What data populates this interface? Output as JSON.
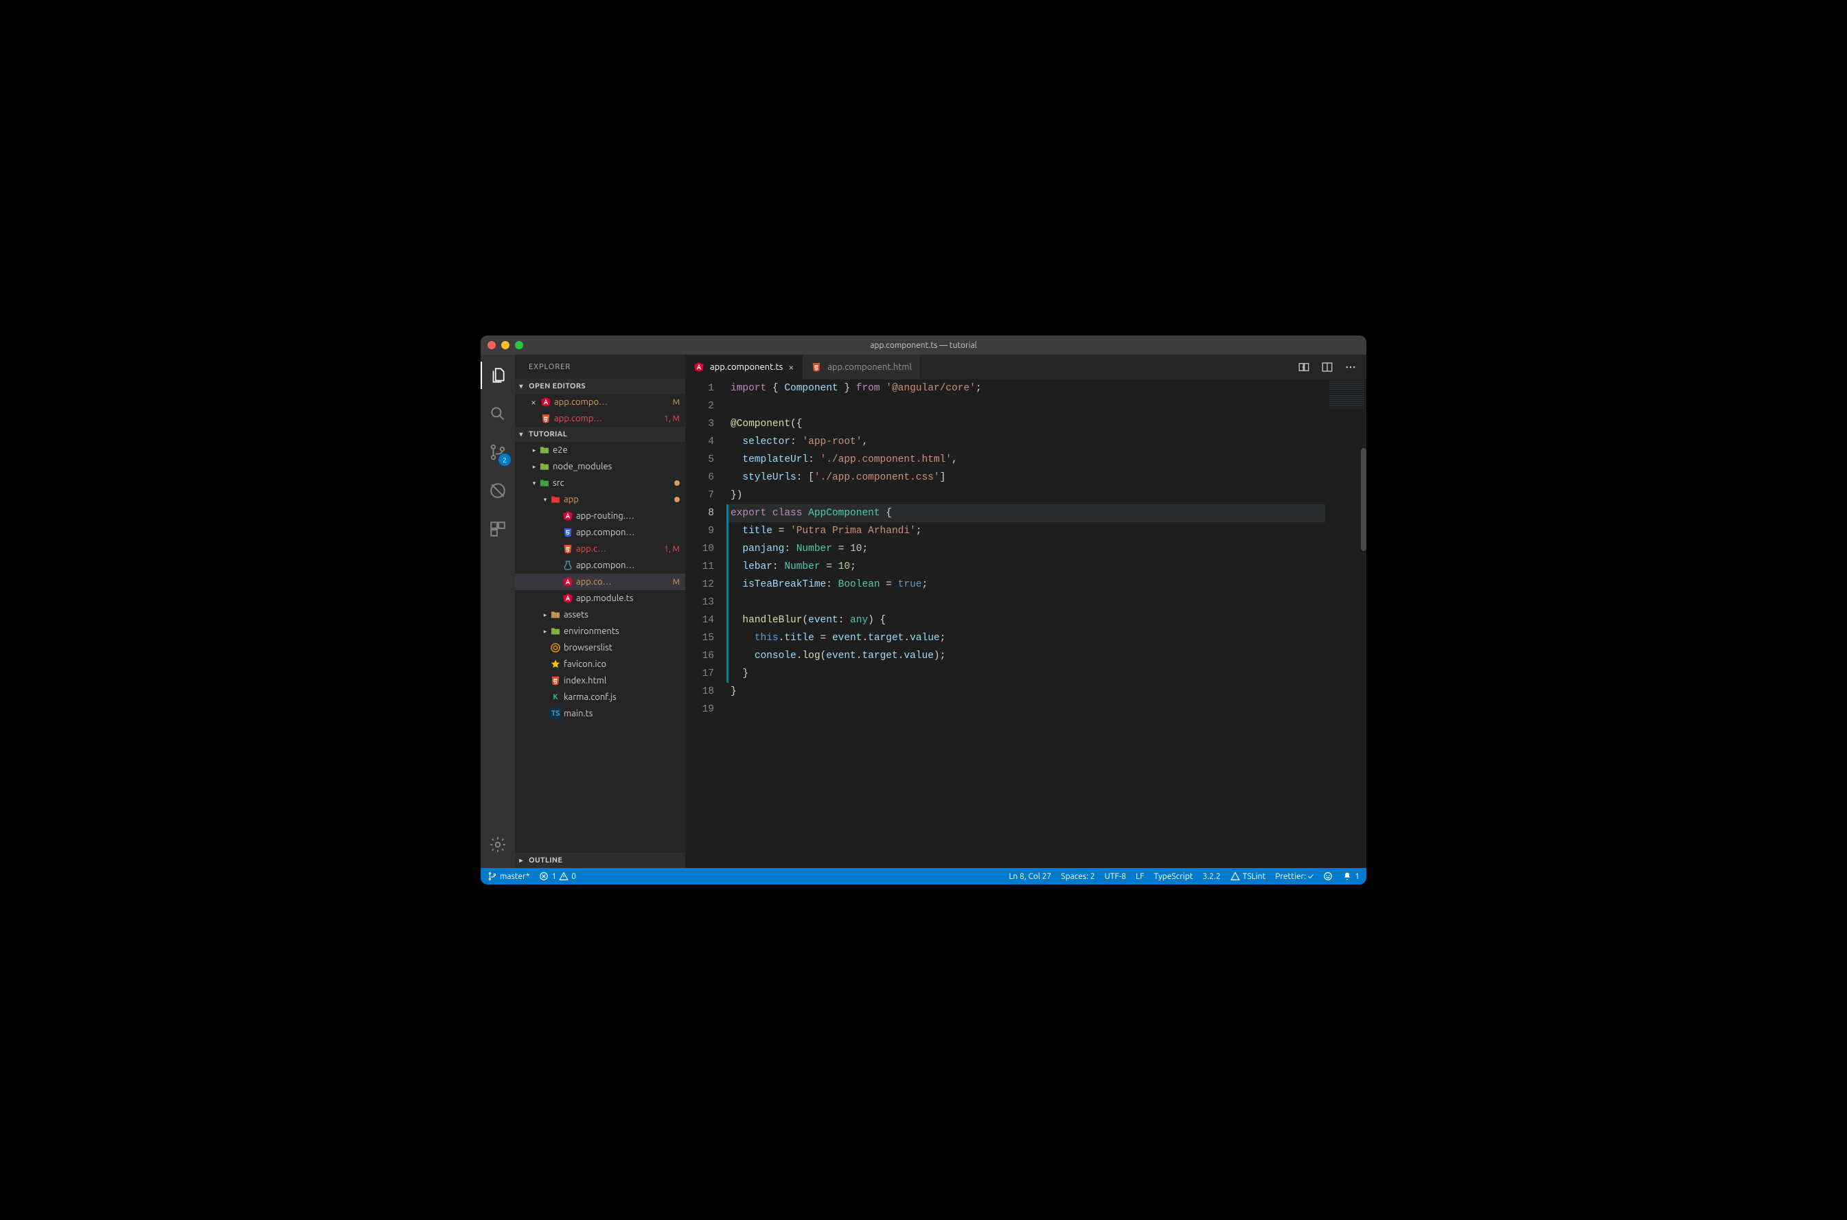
{
  "window": {
    "title": "app.component.ts — tutorial"
  },
  "activity": {
    "scm_badge": "2"
  },
  "sidebar": {
    "title": "EXPLORER",
    "sections": {
      "open_editors": "OPEN EDITORS",
      "project": "TUTORIAL",
      "outline": "OUTLINE"
    },
    "open_editors": [
      {
        "label": "app.compo…",
        "icon": "angular",
        "status": "M",
        "modified": true,
        "active": true
      },
      {
        "label": "app.comp…",
        "icon": "html",
        "status": "1, M",
        "error": true
      }
    ],
    "tree": [
      {
        "depth": 1,
        "twisty": "right",
        "icon": "folder-g",
        "label": "e2e"
      },
      {
        "depth": 1,
        "twisty": "right",
        "icon": "folder-g",
        "label": "node_modules"
      },
      {
        "depth": 1,
        "twisty": "down",
        "icon": "folder-src",
        "label": "src",
        "dot": true
      },
      {
        "depth": 2,
        "twisty": "down",
        "icon": "folder-app",
        "label": "app",
        "dot": true,
        "modified": true
      },
      {
        "depth": 3,
        "icon": "angular",
        "label": "app-routing.…"
      },
      {
        "depth": 3,
        "icon": "css",
        "label": "app.compon…"
      },
      {
        "depth": 3,
        "icon": "html",
        "label": "app.c…",
        "status": "1, M",
        "error": true
      },
      {
        "depth": 3,
        "icon": "ts-test",
        "label": "app.compon…"
      },
      {
        "depth": 3,
        "icon": "angular",
        "label": "app.co…",
        "status": "M",
        "modified": true,
        "selected": true
      },
      {
        "depth": 3,
        "icon": "angular",
        "label": "app.module.ts"
      },
      {
        "depth": 2,
        "twisty": "right",
        "icon": "folder",
        "label": "assets"
      },
      {
        "depth": 2,
        "twisty": "right",
        "icon": "folder-g",
        "label": "environments"
      },
      {
        "depth": 2,
        "icon": "browserslist",
        "label": "browserslist"
      },
      {
        "depth": 2,
        "icon": "star",
        "label": "favicon.ico"
      },
      {
        "depth": 2,
        "icon": "html",
        "label": "index.html"
      },
      {
        "depth": 2,
        "icon": "karma",
        "label": "karma.conf.js"
      },
      {
        "depth": 2,
        "icon": "ts",
        "label": "main.ts"
      }
    ]
  },
  "tabs": [
    {
      "label": "app.component.ts",
      "icon": "angular",
      "active": true,
      "close": true
    },
    {
      "label": "app.component.html",
      "icon": "html",
      "active": false
    }
  ],
  "editor": {
    "lines": [
      {
        "n": 1,
        "html": "<span class='kw'>import</span><span class='pl'> { </span><span class='prop'>Component</span><span class='pl'> } </span><span class='kw'>from</span><span class='pl'> </span><span class='st'>'@angular/core'</span><span class='pl'>;</span>"
      },
      {
        "n": 2,
        "html": ""
      },
      {
        "n": 3,
        "html": "<span class='fn'>@Component</span><span class='pl'>({</span>"
      },
      {
        "n": 4,
        "html": "<span class='pl'>  </span><span class='prop'>selector</span><span class='pl'>: </span><span class='st'>'app-root'</span><span class='pl'>,</span>"
      },
      {
        "n": 5,
        "html": "<span class='pl'>  </span><span class='prop'>templateUrl</span><span class='pl'>: </span><span class='st'>'./app.component.html'</span><span class='pl'>,</span>"
      },
      {
        "n": 6,
        "html": "<span class='pl'>  </span><span class='prop'>styleUrls</span><span class='pl'>: [</span><span class='st'>'./app.component.css'</span><span class='pl'>]</span>"
      },
      {
        "n": 7,
        "html": "<span class='pl'>})</span>"
      },
      {
        "n": 8,
        "html": "<span class='kw'>export</span><span class='pl'> </span><span class='kw'>class</span><span class='pl'> </span><span class='cl'>AppComponent</span><span class='pl'> {</span>",
        "current": true
      },
      {
        "n": 9,
        "html": "<span class='pl'>  </span><span class='prop'>title</span><span class='pl'> = </span><span class='st'>'Putra Prima Arhandi'</span><span class='pl'>;</span>"
      },
      {
        "n": 10,
        "html": "<span class='pl'>  </span><span class='prop'>panjang</span><span class='pl'>: </span><span class='cl'>Number</span><span class='pl'> = </span><span class='num'>10</span><span class='pl'>;</span>"
      },
      {
        "n": 11,
        "html": "<span class='pl'>  </span><span class='prop'>lebar</span><span class='pl'>: </span><span class='cl'>Number</span><span class='pl'> = </span><span class='num'>10</span><span class='pl'>;</span>"
      },
      {
        "n": 12,
        "html": "<span class='pl'>  </span><span class='prop'>isTeaBreakTime</span><span class='pl'>: </span><span class='cl'>Boolean</span><span class='pl'> = </span><span class='bool'>true</span><span class='pl'>;</span>"
      },
      {
        "n": 13,
        "html": ""
      },
      {
        "n": 14,
        "html": "<span class='pl'>  </span><span class='fn'>handleBlur</span><span class='pl'>(</span><span class='prop'>event</span><span class='pl'>: </span><span class='any'>any</span><span class='pl'>) {</span>"
      },
      {
        "n": 15,
        "html": "<span class='pl'>    </span><span class='this'>this</span><span class='pl'>.</span><span class='prop'>title</span><span class='pl'> = </span><span class='prop'>event</span><span class='pl'>.</span><span class='prop'>target</span><span class='pl'>.</span><span class='prop'>value</span><span class='pl'>;</span>"
      },
      {
        "n": 16,
        "html": "<span class='pl'>    </span><span class='prop'>console</span><span class='pl'>.</span><span class='fn'>log</span><span class='pl'>(</span><span class='prop'>event</span><span class='pl'>.</span><span class='prop'>target</span><span class='pl'>.</span><span class='prop'>value</span><span class='pl'>);</span>"
      },
      {
        "n": 17,
        "html": "<span class='pl'>  }</span>"
      },
      {
        "n": 18,
        "html": "<span class='pl'>}</span>"
      },
      {
        "n": 19,
        "html": ""
      }
    ],
    "modbar": {
      "from": 8,
      "to": 17
    }
  },
  "status": {
    "branch": "master*",
    "errors": "1",
    "warnings": "0",
    "cursor": "Ln 8, Col 27",
    "spaces": "Spaces: 2",
    "encoding": "UTF-8",
    "eol": "LF",
    "lang": "TypeScript",
    "tsver": "3.2.2",
    "tslint": "TSLint",
    "prettier": "Prettier: ✓",
    "bell": "1"
  }
}
